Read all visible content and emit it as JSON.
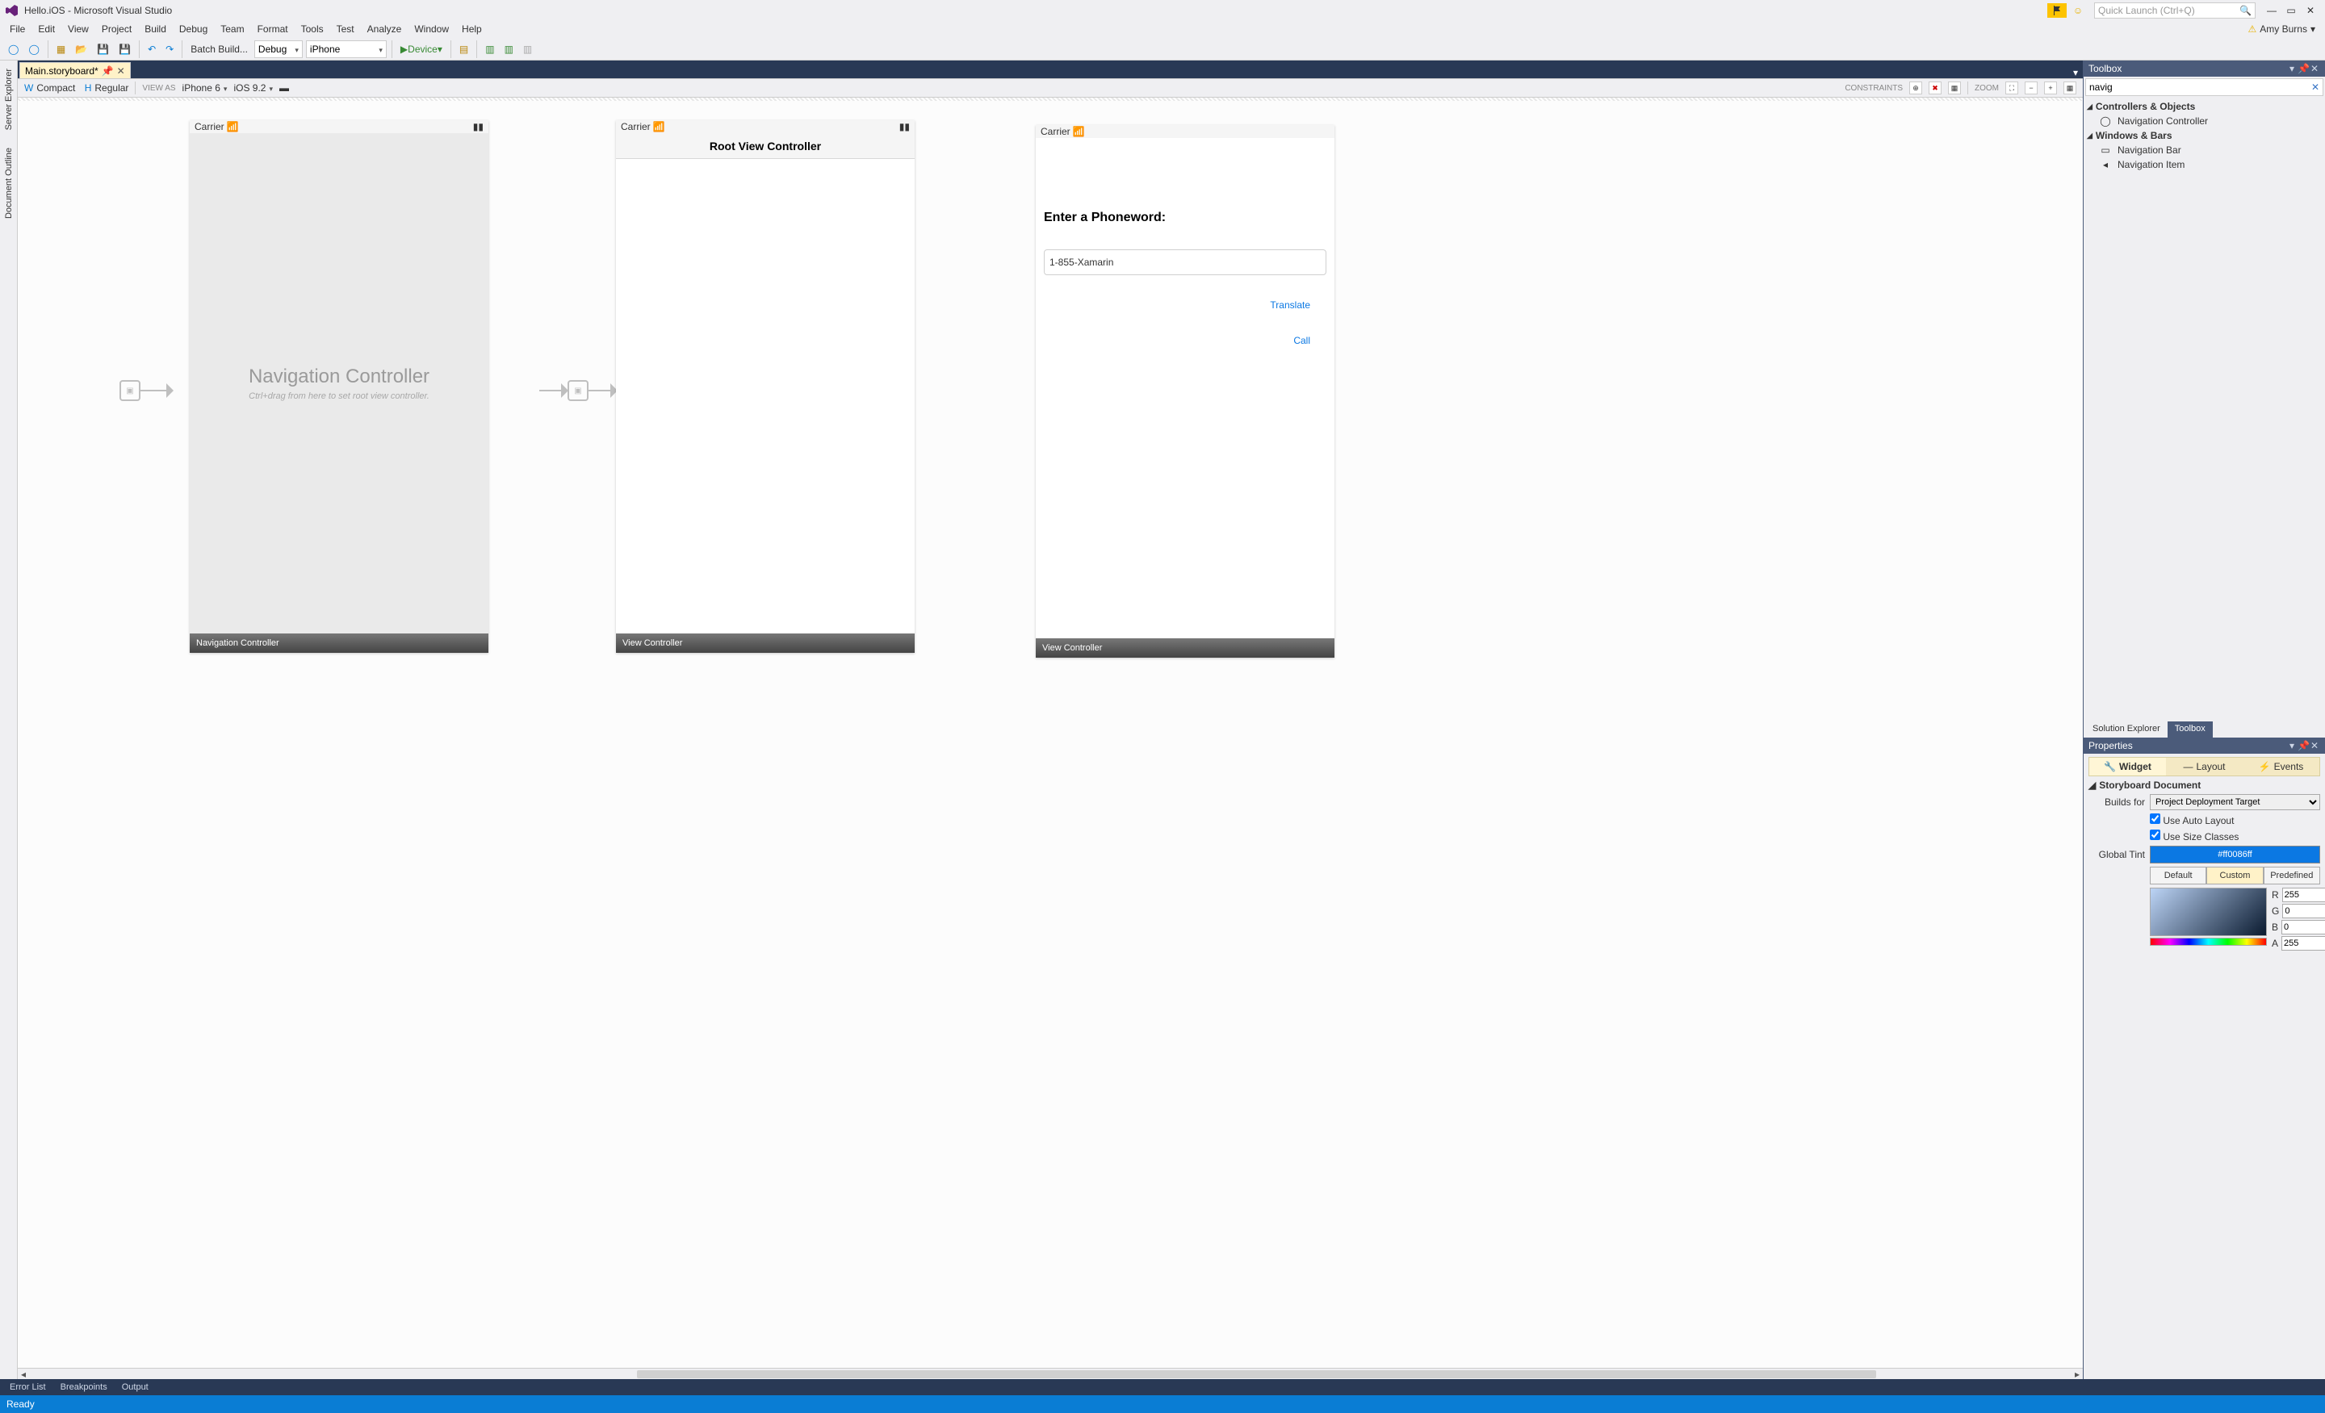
{
  "title": "Hello.iOS - Microsoft Visual Studio",
  "quick_launch_placeholder": "Quick Launch (Ctrl+Q)",
  "user_name": "Amy Burns",
  "menu": [
    "File",
    "Edit",
    "View",
    "Project",
    "Build",
    "Debug",
    "Team",
    "Format",
    "Tools",
    "Test",
    "Analyze",
    "Window",
    "Help"
  ],
  "toolbar": {
    "batch": "Batch Build...",
    "config": "Debug",
    "platform": "iPhone",
    "device": "Device"
  },
  "side_tabs": [
    "Server Explorer",
    "Document Outline"
  ],
  "doc_tab": "Main.storyboard*",
  "size_class": {
    "w": "Compact",
    "h": "Regular"
  },
  "view_as": "VIEW AS",
  "device_sel": "iPhone 6",
  "ios_sel": "iOS 9.2",
  "constraints_label": "CONSTRAINTS",
  "zoom_label": "ZOOM",
  "phone1": {
    "carrier": "Carrier",
    "big": "Navigation Controller",
    "hint": "Ctrl+drag from here to set root view controller.",
    "footer": "Navigation Controller"
  },
  "phone2": {
    "carrier": "Carrier",
    "navtitle": "Root View Controller",
    "footer": "View Controller"
  },
  "phone3": {
    "carrier": "Carrier",
    "lbl": "Enter a Phoneword:",
    "tf": "1-855-Xamarin",
    "translate": "Translate",
    "call": "Call",
    "footer": "View Controller"
  },
  "toolbox": {
    "title": "Toolbox",
    "search": "navig",
    "group1": "Controllers & Objects",
    "g1_items": [
      "Navigation Controller"
    ],
    "group2": "Windows & Bars",
    "g2_items": [
      "Navigation Bar",
      "Navigation Item"
    ],
    "tabs": [
      "Solution Explorer",
      "Toolbox"
    ]
  },
  "properties": {
    "title": "Properties",
    "tabs": [
      "Widget",
      "Layout",
      "Events"
    ],
    "section": "Storyboard Document",
    "builds_for": "Builds for",
    "builds_for_value": "Project Deployment Target",
    "auto_layout": "Use Auto Layout",
    "size_classes": "Use Size Classes",
    "global_tint": "Global Tint",
    "tint_value": "#ff0086ff",
    "btns": [
      "Default",
      "Custom",
      "Predefined"
    ],
    "r": "255",
    "g": "0",
    "b": "0",
    "a": "255"
  },
  "bottom_tabs": [
    "Error List",
    "Breakpoints",
    "Output"
  ],
  "status": "Ready"
}
